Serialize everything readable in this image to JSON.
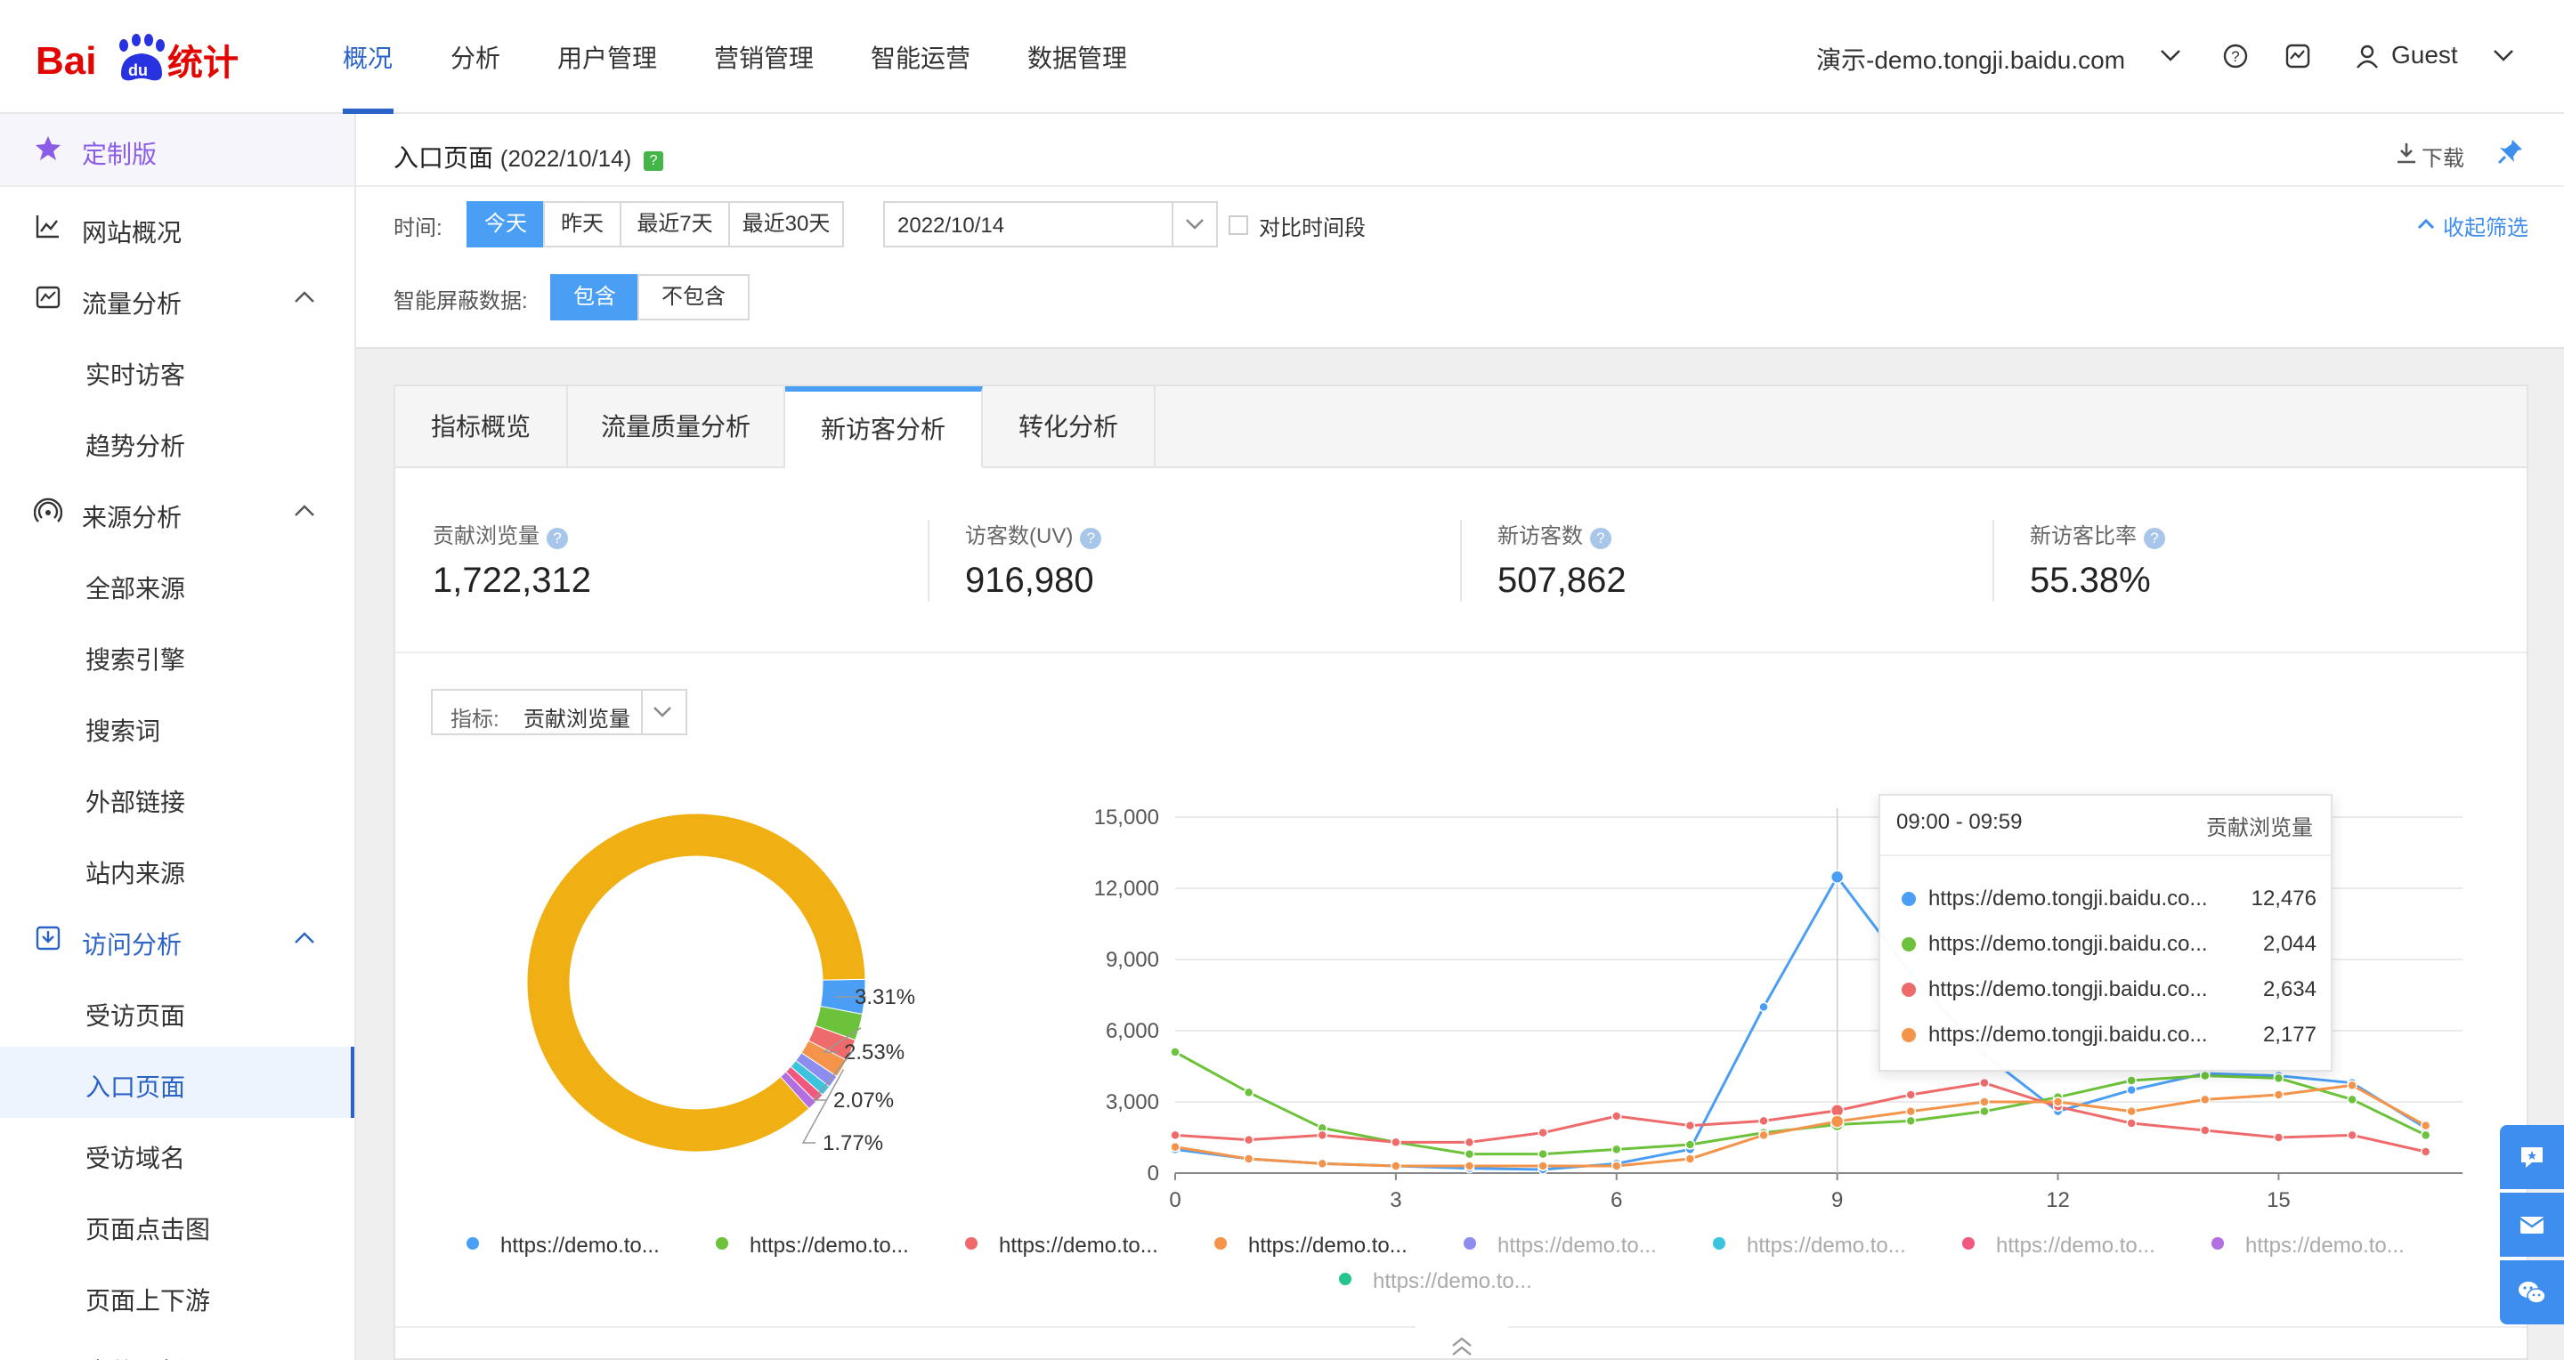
{
  "header": {
    "logo_text": "Baidu统计",
    "nav": [
      {
        "label": "概况",
        "active": true
      },
      {
        "label": "分析"
      },
      {
        "label": "用户管理"
      },
      {
        "label": "营销管理"
      },
      {
        "label": "智能运营"
      },
      {
        "label": "数据管理"
      }
    ],
    "site_selector": "演示-demo.tongji.baidu.com",
    "user": "Guest",
    "accent": "#2b62c7"
  },
  "sidebar": {
    "items": [
      {
        "label": "定制版",
        "icon": "star-icon"
      },
      {
        "label": "网站概况",
        "icon": "line-chart-icon"
      },
      {
        "label": "流量分析",
        "icon": "traffic-icon"
      },
      {
        "label": "实时访客"
      },
      {
        "label": "趋势分析"
      },
      {
        "label": "来源分析",
        "icon": "signal-icon"
      },
      {
        "label": "全部来源"
      },
      {
        "label": "搜索引擎"
      },
      {
        "label": "搜索词"
      },
      {
        "label": "外部链接"
      },
      {
        "label": "站内来源"
      },
      {
        "label": "访问分析",
        "icon": "visit-icon"
      },
      {
        "label": "受访页面"
      },
      {
        "label": "入口页面",
        "active": true
      },
      {
        "label": "受访域名"
      },
      {
        "label": "页面点击图"
      },
      {
        "label": "页面上下游"
      },
      {
        "label": "事件分析"
      }
    ]
  },
  "page": {
    "title": "入口页面",
    "date": "(2022/10/14)",
    "download": "下载",
    "collapse": "收起筛选"
  },
  "filters": {
    "time_label": "时间:",
    "time_options": [
      "今天",
      "昨天",
      "最近7天",
      "最近30天"
    ],
    "date_value": "2022/10/14",
    "compare_label": "对比时间段",
    "mask_label": "智能屏蔽数据:",
    "mask_options": [
      "包含",
      "不包含"
    ]
  },
  "tabs": [
    "指标概览",
    "流量质量分析",
    "新访客分析",
    "转化分析"
  ],
  "metrics": [
    {
      "label": "贡献浏览量",
      "value": "1,722,312"
    },
    {
      "label": "访客数(UV)",
      "value": "916,980"
    },
    {
      "label": "新访客数",
      "value": "507,862"
    },
    {
      "label": "新访客比率",
      "value": "55.38%"
    }
  ],
  "indicator": {
    "label": "指标:",
    "value": "贡献浏览量"
  },
  "chart_data": [
    {
      "type": "pie",
      "values": [
        86.3,
        3.31,
        2.53,
        2.07,
        1.77,
        1.2,
        1.0,
        0.9,
        0.92
      ],
      "labels": [
        "",
        "3.31%",
        "2.53%",
        "2.07%",
        "1.77%",
        "",
        "",
        "",
        ""
      ],
      "colors": [
        "#f0b013",
        "#4a9ff5",
        "#6cc23a",
        "#ef6b6b",
        "#f4944a",
        "#8d8df0",
        "#3cc3de",
        "#f0587d",
        "#b36ee0",
        "#27c48e"
      ]
    },
    {
      "type": "line",
      "x": [
        0,
        1,
        2,
        3,
        4,
        5,
        6,
        7,
        8,
        9,
        10,
        11,
        12,
        13,
        14,
        15,
        16,
        17
      ],
      "xticks": [
        "0",
        "3",
        "6",
        "9",
        "12",
        "15"
      ],
      "yticks": [
        "0",
        "3,000",
        "6,000",
        "9,000",
        "12,000",
        "15,000"
      ],
      "ylim": [
        0,
        15000
      ],
      "series": [
        {
          "color": "#4a9ff5",
          "values": [
            1000,
            600,
            400,
            300,
            200,
            150,
            400,
            1000,
            7000,
            12476,
            8400,
            5000,
            2600,
            3500,
            4200,
            4100,
            3800,
            1900
          ]
        },
        {
          "color": "#6cc23a",
          "values": [
            5100,
            3400,
            1900,
            1300,
            800,
            800,
            1000,
            1200,
            1700,
            2044,
            2200,
            2600,
            3200,
            3900,
            4100,
            4000,
            3100,
            1600
          ]
        },
        {
          "color": "#ef6b6b",
          "values": [
            1600,
            1400,
            1600,
            1300,
            1300,
            1700,
            2400,
            2000,
            2200,
            2634,
            3300,
            3800,
            2800,
            2100,
            1800,
            1500,
            1600,
            900
          ]
        },
        {
          "color": "#f4944a",
          "values": [
            1100,
            600,
            400,
            300,
            300,
            300,
            300,
            600,
            1600,
            2177,
            2600,
            3000,
            3000,
            2600,
            3100,
            3300,
            3700,
            2000
          ]
        }
      ]
    }
  ],
  "tooltip": {
    "time": "09:00 - 09:59",
    "metric": "贡献浏览量",
    "rows": [
      {
        "name": "https://demo.tongji.baidu.co...",
        "value": "12,476",
        "color": "#4a9ff5"
      },
      {
        "name": "https://demo.tongji.baidu.co...",
        "value": "2,044",
        "color": "#6cc23a"
      },
      {
        "name": "https://demo.tongji.baidu.co...",
        "value": "2,634",
        "color": "#ef6b6b"
      },
      {
        "name": "https://demo.tongji.baidu.co...",
        "value": "2,177",
        "color": "#f4944a"
      }
    ]
  },
  "legend": [
    {
      "label": "https://demo.to...",
      "color": "#4a9ff5",
      "dim": false
    },
    {
      "label": "https://demo.to...",
      "color": "#6cc23a",
      "dim": false
    },
    {
      "label": "https://demo.to...",
      "color": "#ef6b6b",
      "dim": false
    },
    {
      "label": "https://demo.to...",
      "color": "#f4944a",
      "dim": false
    },
    {
      "label": "https://demo.to...",
      "color": "#8d8df0",
      "dim": true
    },
    {
      "label": "https://demo.to...",
      "color": "#3cc3de",
      "dim": true
    },
    {
      "label": "https://demo.to...",
      "color": "#f0587d",
      "dim": true
    },
    {
      "label": "https://demo.to...",
      "color": "#b36ee0",
      "dim": true
    },
    {
      "label": "https://demo.to...",
      "color": "#27c48e",
      "dim": true
    }
  ]
}
